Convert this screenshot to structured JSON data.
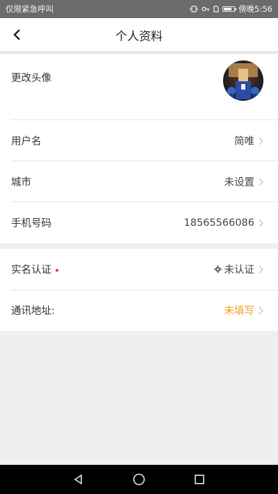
{
  "statusbar": {
    "left_text": "仅限紧急呼叫",
    "time": "傍晚5:56",
    "battery_level": 0.8
  },
  "navbar": {
    "title": "个人资料",
    "back_icon": "chevron-left-icon"
  },
  "profile": {
    "avatar_label": "更改头像",
    "rows": [
      {
        "label": "用户名",
        "value": "简唯"
      },
      {
        "label": "城市",
        "value": "未设置"
      },
      {
        "label": "手机号码",
        "value": "18565566086"
      }
    ]
  },
  "verification": {
    "realname_label": "实名认证",
    "realname_value": "未认证",
    "address_label": "通讯地址:",
    "address_value": "未填写"
  },
  "colors": {
    "accent_orange": "#f0a020",
    "required_dot": "#e53935"
  },
  "system_nav": [
    "back-triangle-icon",
    "home-circle-icon",
    "recents-square-icon"
  ]
}
